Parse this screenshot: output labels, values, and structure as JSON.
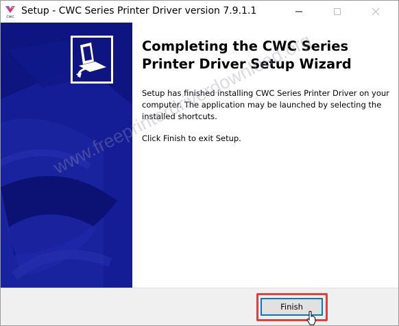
{
  "window": {
    "title": "Setup - CWC Series Printer Driver version 7.9.1.1"
  },
  "titlebar_icons": {
    "app": "cwc-printer-icon",
    "minimize": "minimize-icon",
    "maximize": "maximize-icon",
    "close": "close-icon"
  },
  "content": {
    "heading": "Completing the CWC Series Printer Driver Setup Wizard",
    "body": "Setup has finished installing CWC Series Printer Driver on your computer. The application may be launched by selecting the installed shortcuts.",
    "exit_instruction": "Click Finish to exit Setup."
  },
  "watermark": "www.freeprinterdriverdownload.org",
  "footer": {
    "finish_label": "Finish"
  },
  "colors": {
    "sidebar_bg": "#0e1480",
    "highlight": "#e0403a",
    "button_focus": "#0078d7",
    "footer_bg": "#f0f0f0"
  }
}
